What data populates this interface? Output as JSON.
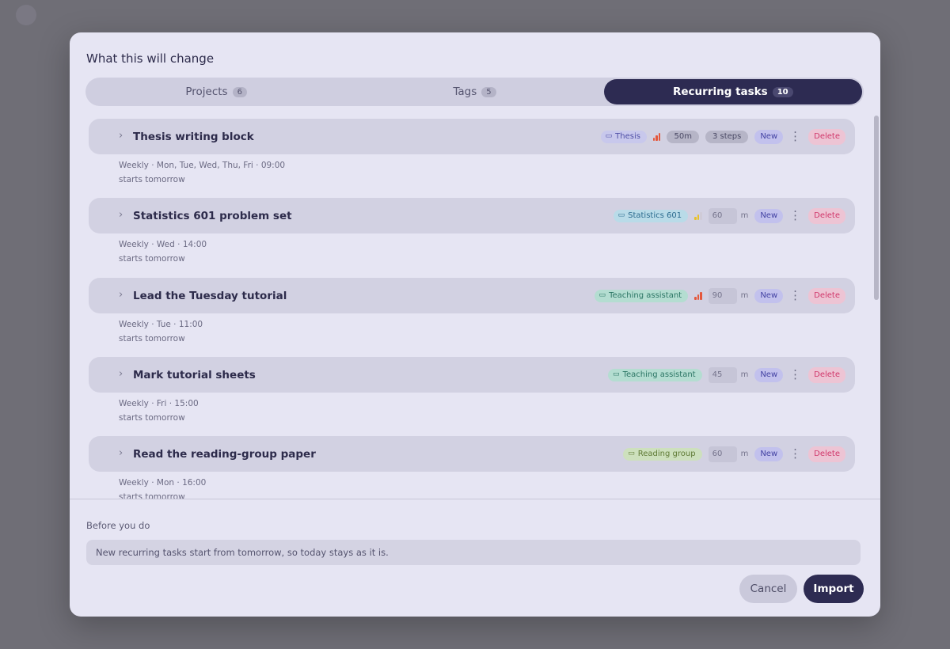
{
  "dialog": {
    "title": "What this will change",
    "tabs": [
      {
        "label": "Projects",
        "count": "6"
      },
      {
        "label": "Tags",
        "count": "5"
      },
      {
        "label": "Recurring tasks",
        "count": "10"
      }
    ],
    "active_tab": "Recurring tasks"
  },
  "tasks": [
    {
      "name": "Thesis writing block",
      "project": "Thesis",
      "project_color": "#c8c8ec",
      "priority": "high",
      "duration": "50m",
      "steps": "3 steps",
      "status": "New",
      "delete_label": "Delete",
      "schedule": "Weekly · Mon, Tue, Wed, Thu, Fri · 09:00",
      "start": "starts tomorrow"
    },
    {
      "name": "Statistics 601 problem set",
      "project": "Statistics 601",
      "project_color": "#b9dbe8",
      "priority": "medium",
      "duration_value": "60",
      "duration_unit": "m",
      "status": "New",
      "delete_label": "Delete",
      "schedule": "Weekly · Wed · 14:00",
      "start": "starts tomorrow"
    },
    {
      "name": "Lead the Tuesday tutorial",
      "project": "Teaching assistant",
      "project_color": "#b4ddd1",
      "priority": "high",
      "duration_value": "90",
      "duration_unit": "m",
      "status": "New",
      "delete_label": "Delete",
      "schedule": "Weekly · Tue · 11:00",
      "start": "starts tomorrow"
    },
    {
      "name": "Mark tutorial sheets",
      "project": "Teaching assistant",
      "project_color": "#b4ddd1",
      "duration_value": "45",
      "duration_unit": "m",
      "status": "New",
      "delete_label": "Delete",
      "schedule": "Weekly · Fri · 15:00",
      "start": "starts tomorrow"
    },
    {
      "name": "Read the reading-group paper",
      "project": "Reading group",
      "project_color": "#cde0bd",
      "duration_value": "60",
      "duration_unit": "m",
      "status": "New",
      "delete_label": "Delete",
      "schedule": "Weekly · Mon · 16:00",
      "start": "starts tomorrow"
    }
  ],
  "footer": {
    "before_label": "Before you do",
    "notice": "New recurring tasks start from tomorrow, so today stays as it is.",
    "cancel_label": "Cancel",
    "import_label": "Import"
  },
  "colors": {
    "accent": "#2d2b52",
    "danger": "#d1386b",
    "new_badge": "#4443a3"
  }
}
